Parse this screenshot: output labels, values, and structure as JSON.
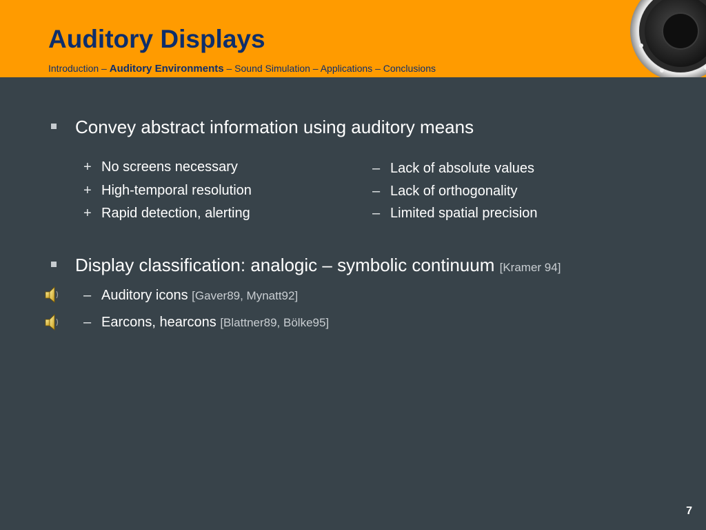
{
  "header": {
    "title": "Auditory Displays",
    "breadcrumb": {
      "before": "Introduction – ",
      "active": "Auditory Environments",
      "after": " – Sound Simulation – Applications – Conclusions"
    }
  },
  "content": {
    "bullet1": "Convey abstract information using auditory means",
    "pros": [
      {
        "sign": "+",
        "text": "No screens necessary"
      },
      {
        "sign": "+",
        "text": "High-temporal resolution"
      },
      {
        "sign": "+",
        "text": "Rapid detection, alerting"
      }
    ],
    "cons": [
      {
        "sign": "–",
        "text": "Lack of absolute values"
      },
      {
        "sign": "–",
        "text": "Lack of orthogonality"
      },
      {
        "sign": "–",
        "text": "Limited spatial precision"
      }
    ],
    "bullet2": {
      "text": "Display classification: analogic – symbolic continuum ",
      "cite": "[Kramer 94]"
    },
    "examples": [
      {
        "sign": "–",
        "text": "Auditory icons ",
        "cite": "[Gaver89, Mynatt92]",
        "icon": "speaker-sound-icon"
      },
      {
        "sign": "–",
        "text": "Earcons, hearcons ",
        "cite": "[Blattner89, Bölke95]",
        "icon": "speaker-sound-icon"
      }
    ]
  },
  "footer": {
    "page_number": "7"
  },
  "colors": {
    "header_bg": "#ff9b00",
    "title": "#0e2e6b",
    "body_bg": "#38434a",
    "text": "#ffffff"
  }
}
